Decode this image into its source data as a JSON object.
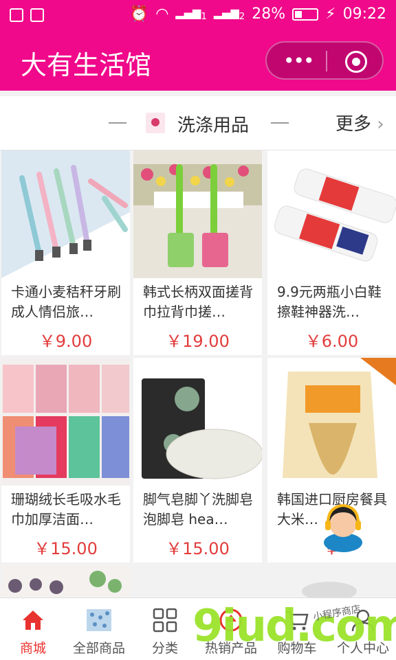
{
  "status_bar": {
    "battery": "28%",
    "time": "09:22",
    "sim1": "1",
    "sim2": "2"
  },
  "header": {
    "title": "大有生活馆",
    "menu_icon": "more-dots-icon",
    "close_icon": "target-icon"
  },
  "section": {
    "title": "洗涤用品",
    "more": "更多"
  },
  "products": [
    {
      "name": "卡通小麦秸秆牙刷成人情侣旅…",
      "price": "￥9.00"
    },
    {
      "name": "韩式长柄双面搓背巾拉背巾搓…",
      "price": "￥19.00"
    },
    {
      "name": "9.9元两瓶小白鞋擦鞋神器洗…",
      "price": "￥6.00"
    },
    {
      "name": "珊瑚绒长毛吸水毛巾加厚洁面…",
      "price": "￥15.00"
    },
    {
      "name": "脚气皂脚丫洗脚皂 泡脚皂 hea…",
      "price": "￥15.00"
    },
    {
      "name": "韩国进口厨房餐具大米…",
      "price": "￥"
    }
  ],
  "tabs": [
    {
      "label": "商城",
      "icon": "home-icon"
    },
    {
      "label": "全部商品",
      "icon": "products-icon"
    },
    {
      "label": "分类",
      "icon": "grid-icon"
    },
    {
      "label": "热销产品",
      "icon": "hot-icon"
    },
    {
      "label": "购物车",
      "icon": "cart-icon"
    },
    {
      "label": "个人中心",
      "icon": "user-icon"
    }
  ],
  "colors": {
    "brand": "#f0098a",
    "price": "#e23c3c",
    "active_tab": "#e8322f"
  },
  "watermark": {
    "text": "9iud.com",
    "small_text": "小程序商店"
  }
}
